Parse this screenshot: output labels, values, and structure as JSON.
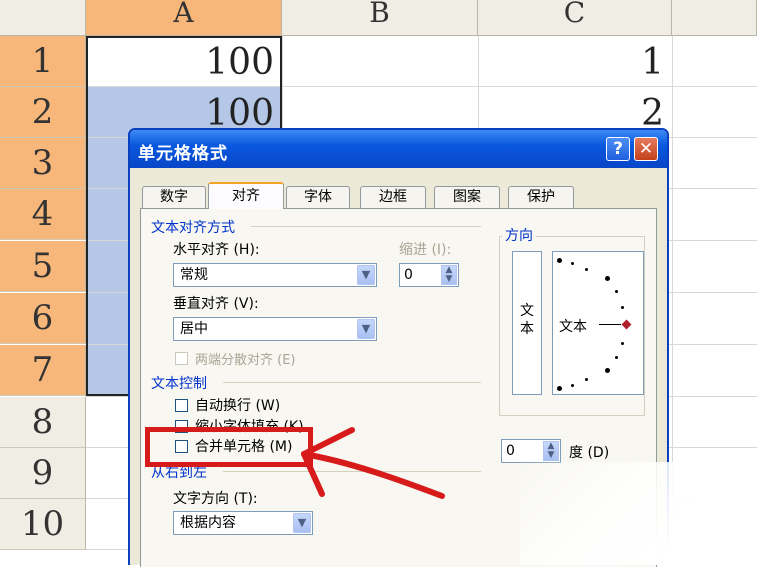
{
  "sheet": {
    "columns": [
      "A",
      "B",
      "C"
    ],
    "rows": [
      "1",
      "2",
      "3",
      "4",
      "5",
      "6",
      "7",
      "8",
      "9",
      "10"
    ],
    "cells": {
      "a1": "100",
      "a2": "100",
      "c1": "1",
      "c2": "2"
    }
  },
  "dialog": {
    "title": "单元格格式",
    "help_label": "?",
    "close_label": "✕",
    "tabs": [
      "数字",
      "对齐",
      "字体",
      "边框",
      "图案",
      "保护"
    ],
    "active_tab": "对齐",
    "text_alignment": {
      "group_label": "文本对齐方式",
      "horizontal_label": "水平对齐 (H):",
      "horizontal_value": "常规",
      "indent_label": "缩进 (I):",
      "indent_value": "0",
      "vertical_label": "垂直对齐 (V):",
      "vertical_value": "居中",
      "justify_distributed_label": "两端分散对齐 (E)"
    },
    "text_control": {
      "group_label": "文本控制",
      "wrap_text_label": "自动换行 (W)",
      "shrink_to_fit_label": "缩小字体填充 (K)",
      "merge_cells_label": "合并单元格 (M)"
    },
    "right_to_left": {
      "group_label": "从右到左",
      "direction_label": "文字方向 (T):",
      "direction_value": "根据内容"
    },
    "orientation": {
      "group_label": "方向",
      "vertical_text": "文本",
      "dial_text": "文本",
      "degree_value": "0",
      "degree_label": "度 (D)"
    }
  },
  "colors": {
    "selected_row_header": "#f7b77b",
    "selection_fill": "#b4c7e6",
    "titlebar": "#0a58e0",
    "annotation": "#d71a1a"
  }
}
